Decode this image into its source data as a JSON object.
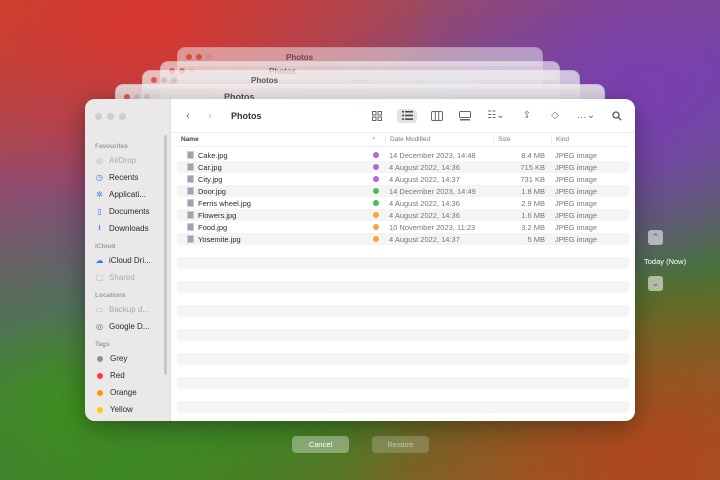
{
  "window": {
    "title": "Photos"
  },
  "ghosts": [
    {
      "title": "Photos"
    },
    {
      "title": "Photos"
    },
    {
      "title": "Photos"
    },
    {
      "title": "Photos"
    }
  ],
  "sidebar": {
    "favourites_label": "Favourites",
    "favourites": [
      {
        "label": "AirDrop",
        "icon": "airdrop-icon",
        "dim": true
      },
      {
        "label": "Recents",
        "icon": "clock-icon",
        "dim": false
      },
      {
        "label": "Applicati...",
        "icon": "applications-icon",
        "dim": false
      },
      {
        "label": "Documents",
        "icon": "document-icon",
        "dim": false
      },
      {
        "label": "Downloads",
        "icon": "download-icon",
        "dim": false
      }
    ],
    "icloud_label": "iCloud",
    "icloud": [
      {
        "label": "iCloud Dri...",
        "icon": "cloud-icon",
        "dim": false
      },
      {
        "label": "Shared",
        "icon": "shared-folder-icon",
        "dim": true
      }
    ],
    "locations_label": "Locations",
    "locations": [
      {
        "label": "Backup d...",
        "icon": "drive-icon",
        "dim": true
      },
      {
        "label": "Google D...",
        "icon": "drive-icon",
        "dim": false
      }
    ],
    "tags_label": "Tags",
    "tags": [
      {
        "label": "Grey",
        "color": "#8e8e93"
      },
      {
        "label": "Red",
        "color": "#ff3b30"
      },
      {
        "label": "Orange",
        "color": "#ff9500"
      },
      {
        "label": "Yellow",
        "color": "#ffcc00"
      }
    ]
  },
  "columns": {
    "name": "Name",
    "date": "Date Modified",
    "size": "Size",
    "kind": "Kind"
  },
  "files": [
    {
      "name": "Cake.jpg",
      "tag": "#b067d8",
      "date": "14 December 2023, 14:48",
      "size": "8.4 MB",
      "kind": "JPEG image"
    },
    {
      "name": "Car.jpg",
      "tag": "#b067d8",
      "date": "4 August 2022, 14:36",
      "size": "715 KB",
      "kind": "JPEG image"
    },
    {
      "name": "City.jpg",
      "tag": "#b067d8",
      "date": "4 August 2022, 14:37",
      "size": "731 KB",
      "kind": "JPEG image"
    },
    {
      "name": "Door.jpg",
      "tag": "#45c150",
      "date": "14 December 2023, 14:49",
      "size": "1.8 MB",
      "kind": "JPEG image"
    },
    {
      "name": "Ferris wheel.jpg",
      "tag": "#45c150",
      "date": "4 August 2022, 14:36",
      "size": "2.9 MB",
      "kind": "JPEG image"
    },
    {
      "name": "Flowers.jpg",
      "tag": "#f6a33c",
      "date": "4 August 2022, 14:36",
      "size": "1.6 MB",
      "kind": "JPEG image"
    },
    {
      "name": "Food.jpg",
      "tag": "#f6a33c",
      "date": "10 November 2023, 11:23",
      "size": "3.2 MB",
      "kind": "JPEG image"
    },
    {
      "name": "Yosemite.jpg",
      "tag": "#f6a33c",
      "date": "4 August 2022, 14:37",
      "size": "5 MB",
      "kind": "JPEG image"
    }
  ],
  "timeline": {
    "label": "Today (Now)"
  },
  "buttons": {
    "cancel": "Cancel",
    "restore": "Restore"
  }
}
